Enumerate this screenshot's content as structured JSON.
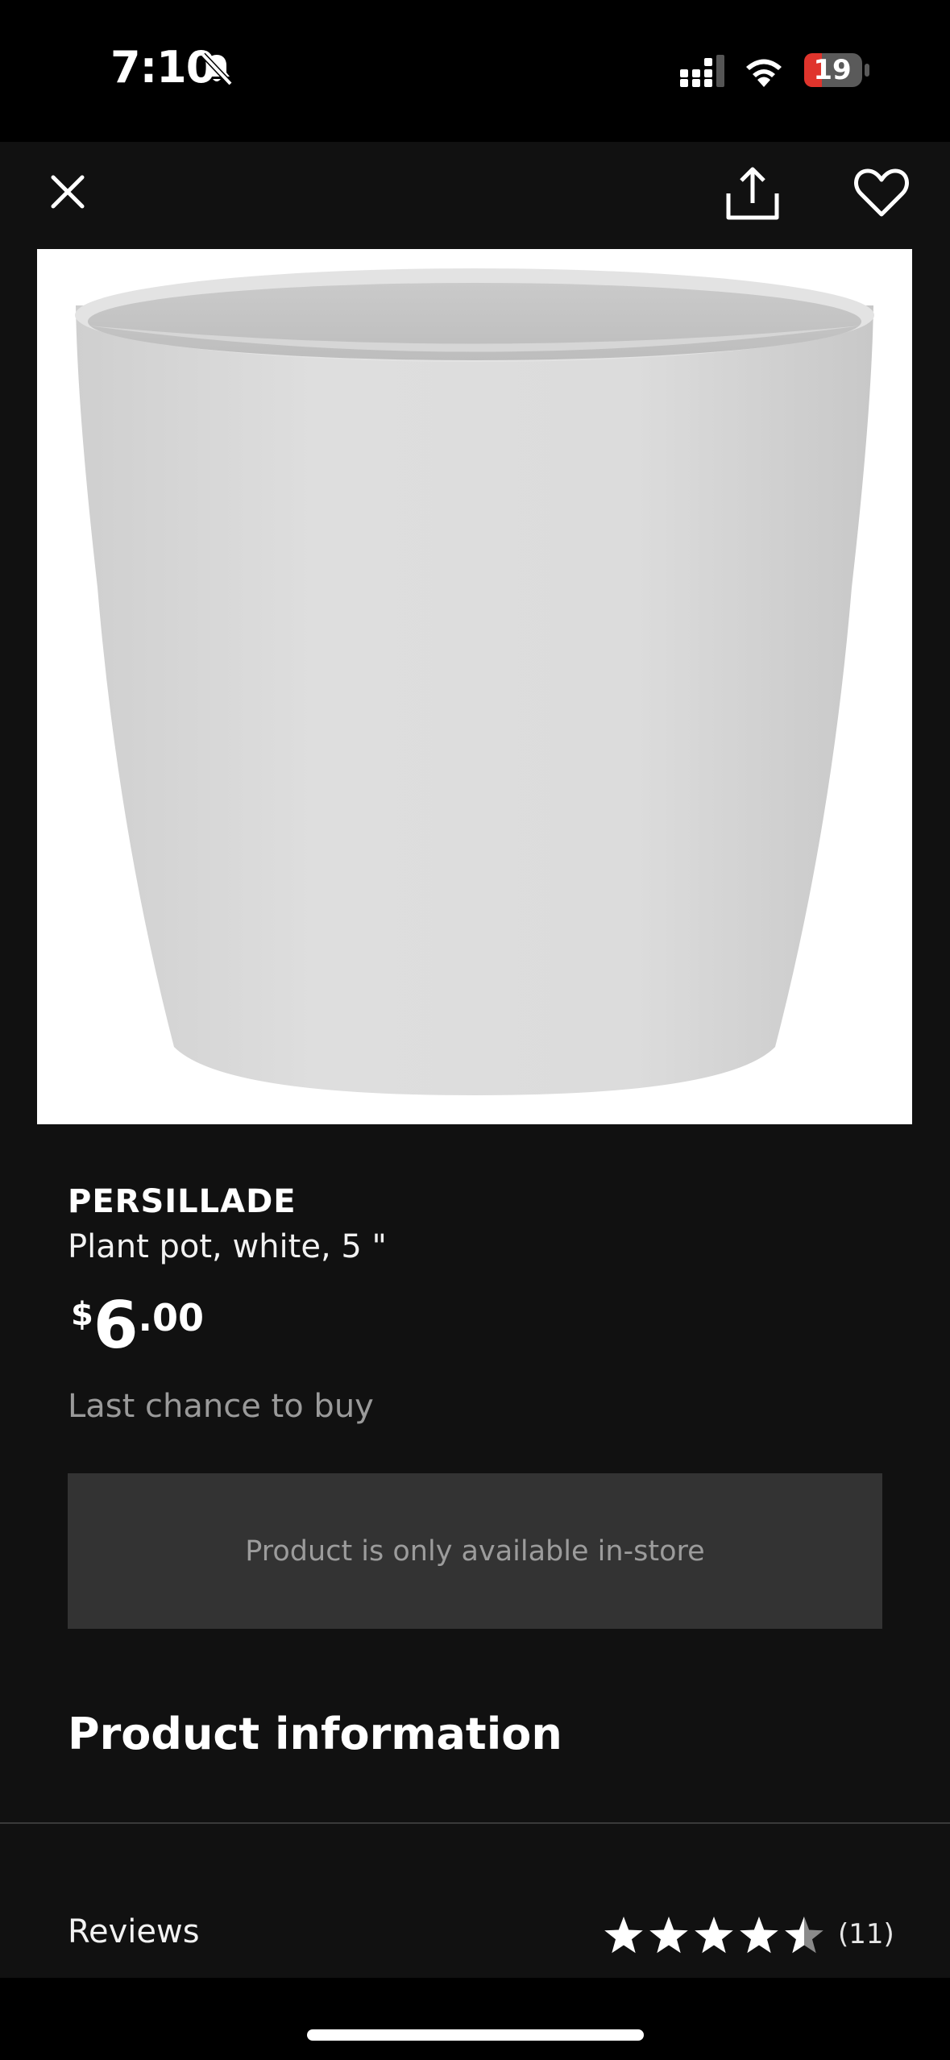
{
  "status_bar": {
    "time": "7:10",
    "battery_level": "19",
    "icons": [
      "bell-muted-icon",
      "cellular-signal-icon",
      "wifi-icon",
      "battery-icon"
    ]
  },
  "toolbar": {
    "icons": [
      "close-icon",
      "share-icon",
      "heart-icon"
    ]
  },
  "product": {
    "name": "PERSILLADE",
    "description": "Plant pot, white, 5 \"",
    "price": {
      "currency": "$",
      "whole": "6",
      "fraction": ".00"
    },
    "availability_note": "Last chance to buy",
    "instore_message": "Product is only available in-store"
  },
  "sections": {
    "product_information": "Product information",
    "reviews_label": "Reviews",
    "reviews_count": "(11)",
    "rating": 4.5,
    "rating_max": 5
  },
  "colors": {
    "background": "#111111",
    "status_bar": "#000000",
    "banner": "#333333",
    "muted_text": "#9a9a9a",
    "battery_red": "#e0342c"
  }
}
